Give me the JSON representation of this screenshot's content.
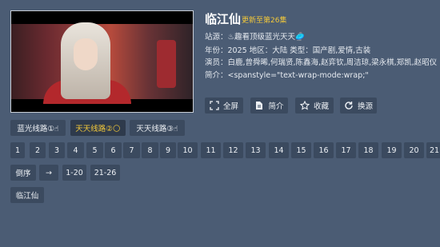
{
  "detail": {
    "title": "临江仙",
    "update": "更新至第26集",
    "source": "站源：♨趣看顶级蓝光天天🥏",
    "info": "年份：2025  地区：大陆  类型：国产剧,爱情,古装",
    "cast": "演员：白鹿,曾舜晞,何瑞贤,陈鑫海,赵弈钦,周洁琼,梁永棋,郑凯,赵昭仪",
    "intro": "简介：<spanstyle=\"text-wrap-mode:wrap;\""
  },
  "actions": [
    {
      "label": "全屏",
      "icon": "fullscreen-icon"
    },
    {
      "label": "简介",
      "icon": "document-icon"
    },
    {
      "label": "收藏",
      "icon": "star-icon"
    },
    {
      "label": "换源",
      "icon": "refresh-icon"
    }
  ],
  "routes": [
    {
      "label": "蓝光线路①☝"
    },
    {
      "label": "天天线路②🌕",
      "selected": true
    },
    {
      "label": "天天线路③☝"
    }
  ],
  "episodes": [
    "1",
    "2",
    "3",
    "4",
    "5",
    "6",
    "7",
    "8",
    "9",
    "10",
    "11",
    "12",
    "13",
    "14",
    "15",
    "16",
    "17",
    "18",
    "19",
    "20",
    "21"
  ],
  "controls": {
    "sort": "倒序",
    "arrow": "→",
    "range1": "1-20",
    "range2": "21-26"
  },
  "tag": "临江仙",
  "colors": {
    "background": "#4b5c74",
    "button": "#3b4a5f",
    "accent": "#f2c83a"
  }
}
